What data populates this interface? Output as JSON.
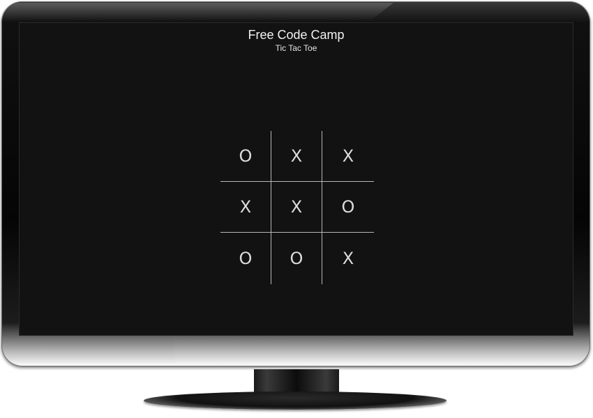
{
  "header": {
    "title": "Free Code Camp",
    "subtitle": "Tic Tac Toe"
  },
  "board": {
    "cells": [
      [
        "O",
        "X",
        "X"
      ],
      [
        "X",
        "X",
        "O"
      ],
      [
        "O",
        "O",
        "X"
      ]
    ]
  },
  "colors": {
    "screen_background": "#121212",
    "text": "#f2f2f2",
    "grid_line": "#b8b8b8",
    "bezel": "#050505"
  }
}
